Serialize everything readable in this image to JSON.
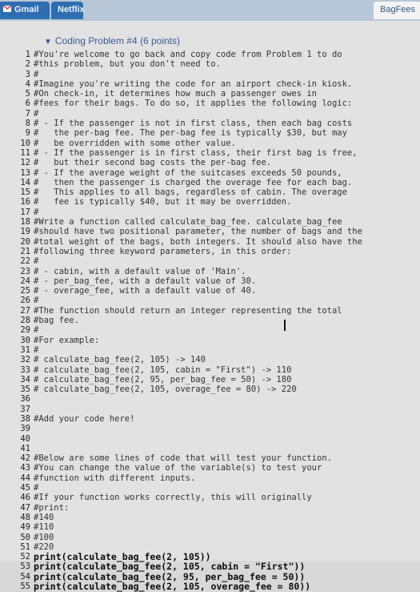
{
  "tabs": [
    {
      "label": "Gmail"
    },
    {
      "label": "Netflix"
    },
    {
      "label": "BagFees"
    }
  ],
  "problem_title": "Coding Problem #4 (6 points)",
  "code_lines": [
    {
      "n": "1",
      "t": "#You're welcome to go back and copy code from Problem 1 to do"
    },
    {
      "n": "2",
      "t": "#this problem, but you don't need to."
    },
    {
      "n": "3",
      "t": "#"
    },
    {
      "n": "4",
      "t": "#Imagine you're writing the code for an airport check-in kiosk."
    },
    {
      "n": "5",
      "t": "#On check-in, it determines how much a passenger owes in"
    },
    {
      "n": "6",
      "t": "#fees for their bags. To do so, it applies the following logic:"
    },
    {
      "n": "7",
      "t": "#"
    },
    {
      "n": "8",
      "t": "# - If the passenger is not in first class, then each bag costs"
    },
    {
      "n": "9",
      "t": "#   the per-bag fee. The per-bag fee is typically $30, but may"
    },
    {
      "n": "10",
      "t": "#   be overridden with some other value."
    },
    {
      "n": "11",
      "t": "# - If the passenger is in first class, their first bag is free,"
    },
    {
      "n": "12",
      "t": "#   but their second bag costs the per-bag fee."
    },
    {
      "n": "13",
      "t": "# - If the average weight of the suitcases exceeds 50 pounds,"
    },
    {
      "n": "14",
      "t": "#   then the passenger is charged the overage fee for each bag."
    },
    {
      "n": "15",
      "t": "#   This applies to all bags, regardless of cabin. The overage"
    },
    {
      "n": "16",
      "t": "#   fee is typically $40, but it may be overridden."
    },
    {
      "n": "17",
      "t": "#"
    },
    {
      "n": "18",
      "t": "#Write a function called calculate_bag_fee. calculate_bag_fee"
    },
    {
      "n": "19",
      "t": "#should have two positional parameter, the number of bags and the"
    },
    {
      "n": "20",
      "t": "#total weight of the bags, both integers. It should also have the"
    },
    {
      "n": "21",
      "t": "#following three keyword parameters, in this order:"
    },
    {
      "n": "22",
      "t": "#"
    },
    {
      "n": "23",
      "t": "# - cabin, with a default value of 'Main'."
    },
    {
      "n": "24",
      "t": "# - per_bag_fee, with a default value of 30."
    },
    {
      "n": "25",
      "t": "# - overage_fee, with a default value of 40."
    },
    {
      "n": "26",
      "t": "#"
    },
    {
      "n": "27",
      "t": "#The function should return an integer representing the total"
    },
    {
      "n": "28",
      "t": "#bag fee."
    },
    {
      "n": "29",
      "t": "#"
    },
    {
      "n": "30",
      "t": "#For example:"
    },
    {
      "n": "31",
      "t": "#"
    },
    {
      "n": "32",
      "t": "# calculate_bag_fee(2, 105) -> 140"
    },
    {
      "n": "33",
      "t": "# calculate_bag_fee(2, 105, cabin = \"First\") -> 110"
    },
    {
      "n": "34",
      "t": "# calculate_bag_fee(2, 95, per_bag_fee = 50) -> 180"
    },
    {
      "n": "35",
      "t": "# calculate_bag_fee(2, 105, overage_fee = 80) -> 220"
    },
    {
      "n": "36",
      "t": ""
    },
    {
      "n": "37",
      "t": ""
    },
    {
      "n": "38",
      "t": "#Add your code here!"
    },
    {
      "n": "39",
      "t": ""
    },
    {
      "n": "40",
      "t": ""
    },
    {
      "n": "41",
      "t": ""
    },
    {
      "n": "42",
      "t": "#Below are some lines of code that will test your function."
    },
    {
      "n": "43",
      "t": "#You can change the value of the variable(s) to test your"
    },
    {
      "n": "44",
      "t": "#function with different inputs."
    },
    {
      "n": "45",
      "t": "#"
    },
    {
      "n": "46",
      "t": "#If your function works correctly, this will originally"
    },
    {
      "n": "47",
      "t": "#print:"
    },
    {
      "n": "48",
      "t": "#140"
    },
    {
      "n": "49",
      "t": "#110"
    },
    {
      "n": "50",
      "t": "#100"
    },
    {
      "n": "51",
      "t": "#220"
    },
    {
      "n": "52",
      "t": "print(calculate_bag_fee(2, 105))"
    },
    {
      "n": "53",
      "t": "print(calculate_bag_fee(2, 105, cabin = \"First\"))"
    },
    {
      "n": "54",
      "t": "print(calculate_bag_fee(2, 95, per_bag_fee = 50))"
    },
    {
      "n": "55",
      "t": "print(calculate_bag_fee(2, 105, overage_fee = 80))"
    }
  ]
}
